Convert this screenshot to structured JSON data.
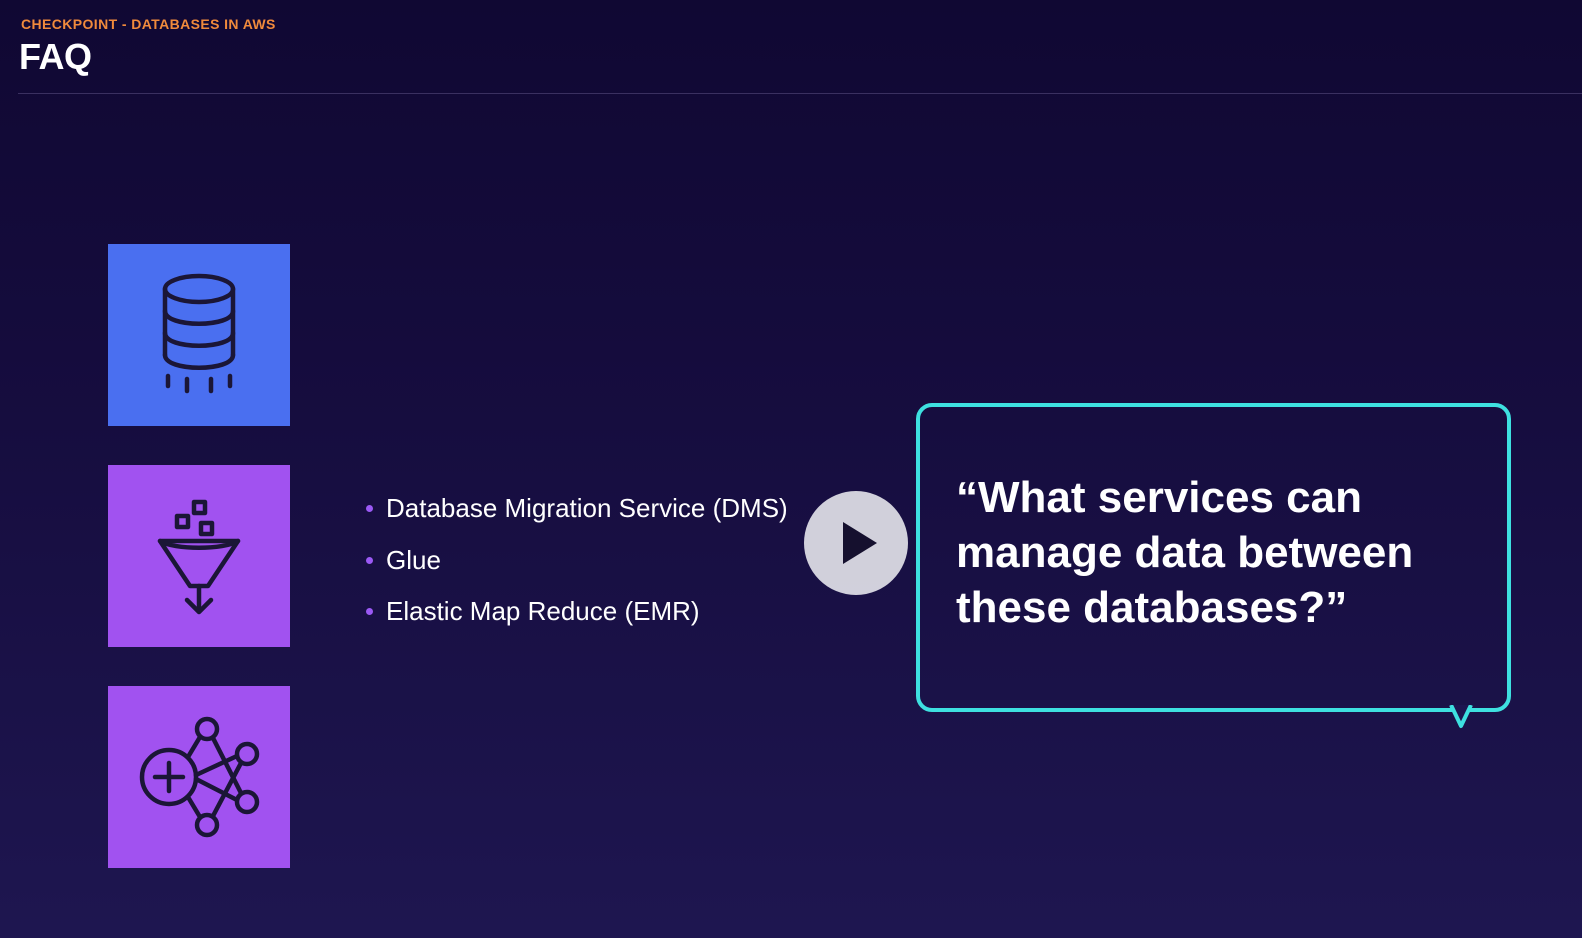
{
  "header": {
    "eyebrow": "CHECKPOINT - DATABASES IN AWS",
    "title": "FAQ"
  },
  "tiles": [
    {
      "icon": "database-icon",
      "color": "#4a6ff0"
    },
    {
      "icon": "funnel-icon",
      "color": "#a152f0"
    },
    {
      "icon": "network-graph-icon",
      "color": "#a152f0"
    }
  ],
  "services": {
    "items": [
      "Database Migration Service (DMS)",
      "Glue",
      "Elastic Map Reduce (EMR)"
    ],
    "bullet_color": "#9b59f5"
  },
  "player": {
    "icon": "play-icon"
  },
  "question": {
    "text": "“What services can manage data between these databases?”",
    "border_color": "#3ee0e0"
  },
  "theme": {
    "eyebrow_color": "#f08a3c",
    "background_top": "#100833",
    "background_bottom": "#1e1650"
  }
}
